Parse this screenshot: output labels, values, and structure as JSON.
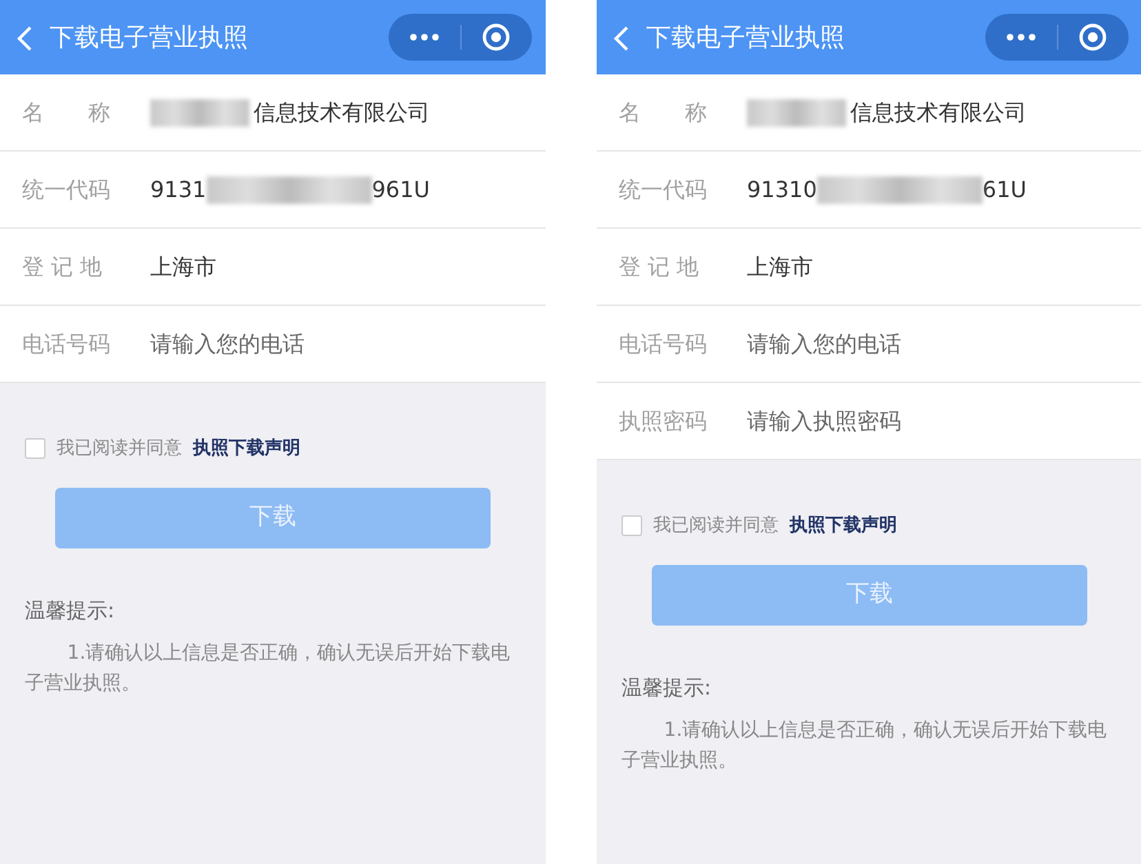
{
  "screens": [
    {
      "title": "下载电子营业执照",
      "rows": [
        {
          "kind": "text",
          "label": "名　　称",
          "redacted_before": true,
          "value": "信息技术有限公司"
        },
        {
          "kind": "split",
          "label": "统一代码",
          "start": "9131",
          "end": "961U"
        },
        {
          "kind": "text",
          "label": "登 记 地",
          "redacted_before": false,
          "value": "上海市"
        },
        {
          "kind": "input",
          "label": "电话号码",
          "placeholder": "请输入您的电话"
        }
      ],
      "agree": {
        "checked": false,
        "text": "我已阅读并同意",
        "link": "执照下载声明"
      },
      "button": {
        "label": "下载",
        "disabled": true
      },
      "tips": {
        "title": "温馨提示:",
        "text": "1.请确认以上信息是否正确，确认无误后开始下载电子营业执照。"
      }
    },
    {
      "title": "下载电子营业执照",
      "rows": [
        {
          "kind": "text",
          "label": "名　　称",
          "redacted_before": true,
          "value": "信息技术有限公司"
        },
        {
          "kind": "split",
          "label": "统一代码",
          "start": "91310",
          "end": "61U"
        },
        {
          "kind": "text",
          "label": "登 记 地",
          "redacted_before": false,
          "value": "上海市"
        },
        {
          "kind": "input",
          "label": "电话号码",
          "placeholder": "请输入您的电话"
        },
        {
          "kind": "input",
          "label": "执照密码",
          "placeholder": "请输入执照密码"
        }
      ],
      "agree": {
        "checked": false,
        "text": "我已阅读并同意",
        "link": "执照下载声明"
      },
      "button": {
        "label": "下载",
        "disabled": true
      },
      "tips": {
        "title": "温馨提示:",
        "text": "1.请确认以上信息是否正确，确认无误后开始下载电子营业执照。"
      }
    }
  ]
}
